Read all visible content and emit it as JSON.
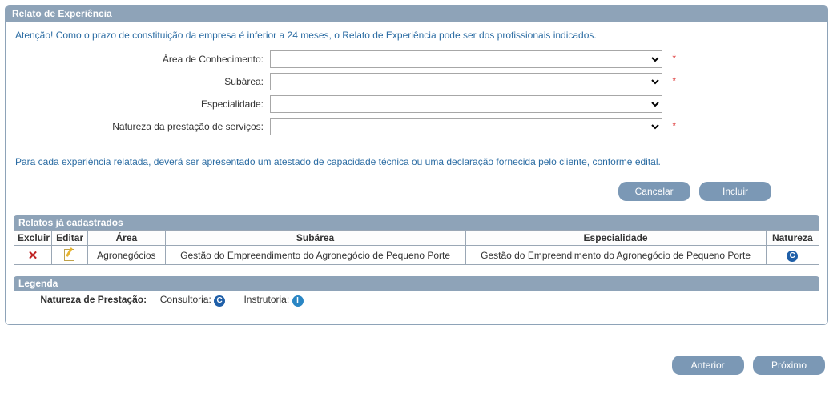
{
  "panel": {
    "title": "Relato de Experiência",
    "warning": "Atenção! Como o prazo de constituição da empresa é inferior a 24 meses, o Relato de Experiência pode ser dos profissionais indicados.",
    "note": "Para cada experiência relatada, deverá ser apresentado um atestado de capacidade técnica ou uma declaração fornecida pelo cliente, conforme edital.",
    "labels": {
      "area": "Área de Conhecimento:",
      "subarea": "Subárea:",
      "especialidade": "Especialidade:",
      "natureza": "Natureza da prestação de serviços:"
    },
    "required_marker": "*",
    "buttons": {
      "cancel": "Cancelar",
      "include": "Incluir"
    }
  },
  "relatos": {
    "title": "Relatos já cadastrados",
    "headers": {
      "excluir": "Excluir",
      "editar": "Editar",
      "area": "Área",
      "subarea": "Subárea",
      "especialidade": "Especialidade",
      "natureza": "Natureza"
    },
    "rows": [
      {
        "area": "Agronegócios",
        "subarea": "Gestão do Empreendimento do Agronegócio de Pequeno Porte",
        "especialidade": "Gestão do Empreendimento do Agronegócio de Pequeno Porte",
        "natureza_badge": "C"
      }
    ]
  },
  "legenda": {
    "title": "Legenda",
    "label": "Natureza de Prestação:",
    "consultoria": "Consultoria:",
    "consultoria_badge": "C",
    "instrutoria": "Instrutoria:",
    "instrutoria_badge": "I"
  },
  "footer": {
    "prev": "Anterior",
    "next": "Próximo"
  }
}
